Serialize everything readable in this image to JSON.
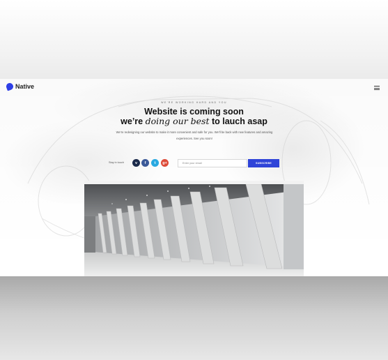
{
  "header": {
    "logo_text": "Native",
    "menu_icon": "hamburger-icon"
  },
  "hero": {
    "kicker": "WE'RE WORKING HARD AND YOU",
    "headline_line1": "Website is coming soon",
    "headline_prefix": "we’re ",
    "headline_emphasis": "doing our best",
    "headline_suffix": " to lauch asap",
    "description": "We’re redesigning our website to make it more convenient and safe for you. We'll be back with new features and amazing experiences. See you soon!"
  },
  "signup": {
    "stay_label": "Stay in touch",
    "social": [
      {
        "icon": "vimeo-icon",
        "glyph": "v",
        "color": "#1a2a4a"
      },
      {
        "icon": "facebook-icon",
        "glyph": "f",
        "color": "#3b5998"
      },
      {
        "icon": "twitter-icon",
        "glyph": "t",
        "color": "#29a9e1"
      },
      {
        "icon": "google-plus-icon",
        "glyph": "g+",
        "color": "#dd4b39"
      }
    ],
    "email_placeholder": "Enter your email",
    "subscribe_label": "SUBSCRIBE"
  },
  "colors": {
    "accent": "#2f44d8",
    "headline": "#111111"
  }
}
